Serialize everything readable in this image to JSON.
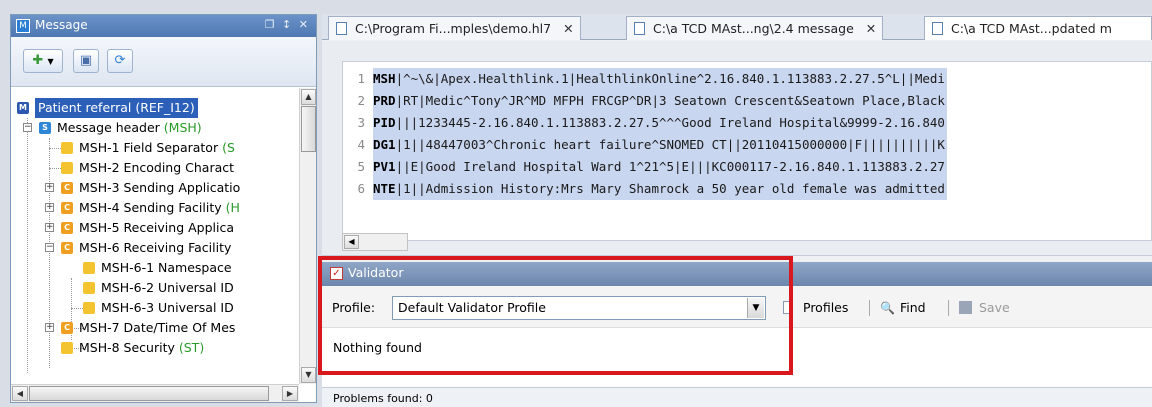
{
  "left_panel": {
    "title": "Message",
    "window_controls": "❐ ↕ ✕",
    "tree": [
      {
        "label": "Patient referral",
        "type": "(REF_I12)",
        "icon": "message-icon"
      },
      {
        "label": "Message header",
        "type": "(MSH)",
        "icon": "segment-icon"
      },
      {
        "label": "MSH-1  Field Separator",
        "type": "(S",
        "icon": "field-icon"
      },
      {
        "label": "MSH-2  Encoding Charact",
        "type": "",
        "icon": "field-icon"
      },
      {
        "label": "MSH-3  Sending Applicatio",
        "type": "",
        "icon": "composite-icon"
      },
      {
        "label": "MSH-4  Sending Facility",
        "type": "(H",
        "icon": "composite-icon"
      },
      {
        "label": "MSH-5  Receiving Applica",
        "type": "",
        "icon": "composite-icon"
      },
      {
        "label": "MSH-6  Receiving Facility",
        "type": "",
        "icon": "composite-icon"
      },
      {
        "label": "MSH-6-1  Namespace",
        "type": "",
        "icon": "field-icon"
      },
      {
        "label": "MSH-6-2  Universal ID",
        "type": "",
        "icon": "field-icon"
      },
      {
        "label": "MSH-6-3  Universal ID",
        "type": "",
        "icon": "field-icon"
      },
      {
        "label": "MSH-7  Date/Time Of Mes",
        "type": "",
        "icon": "composite-icon"
      },
      {
        "label": "MSH-8  Security",
        "type": "(ST)",
        "icon": "field-icon"
      }
    ]
  },
  "tabs": [
    {
      "label": "C:\\Program Fi...mples\\demo.hl7",
      "close": "✕"
    },
    {
      "label": "C:\\a TCD MAst...ng\\2.4 message",
      "close": "✕"
    },
    {
      "label": "C:\\a TCD MAst...pdated m",
      "close": ""
    }
  ],
  "code_lines": [
    {
      "num": "1",
      "seg": "MSH",
      "rest": "|^~\\&|Apex.Healthlink.1|HealthlinkOnline^2.16.840.1.113883.2.27.5^L||Medi"
    },
    {
      "num": "2",
      "seg": "PRD",
      "rest": "|RT|Medic^Tony^JR^MD MFPH FRCGP^DR|3 Seatown Crescent&Seatown Place,Black"
    },
    {
      "num": "3",
      "seg": "PID",
      "rest": "|||1233445-2.16.840.1.113883.2.27.5^^^Good Ireland Hospital&9999-2.16.840"
    },
    {
      "num": "4",
      "seg": "DG1",
      "rest": "|1||48447003^Chronic heart failure^SNOMED CT||20110415000000|F||||||||||K"
    },
    {
      "num": "5",
      "seg": "PV1",
      "rest": "||E|Good Ireland Hospital Ward 1^21^5|E|||KC000117-2.16.840.1.113883.2.27"
    },
    {
      "num": "6",
      "seg": "NTE",
      "rest": "|1||Admission History:Mrs Mary Shamrock a 50 year old female was admitted"
    }
  ],
  "validator": {
    "title": "Validator",
    "profile_label": "Profile:",
    "profile_value": "Default Validator Profile",
    "profiles_label": "Profiles",
    "find_label": "Find",
    "save_label": "Save",
    "result": "Nothing found"
  },
  "status": {
    "problems": "Problems found: 0"
  },
  "colors": {
    "highlight": "#d8181c",
    "selection": "#2b5fb8",
    "code_selection": "#c9d6ef",
    "type_text": "#2a9a2a"
  }
}
